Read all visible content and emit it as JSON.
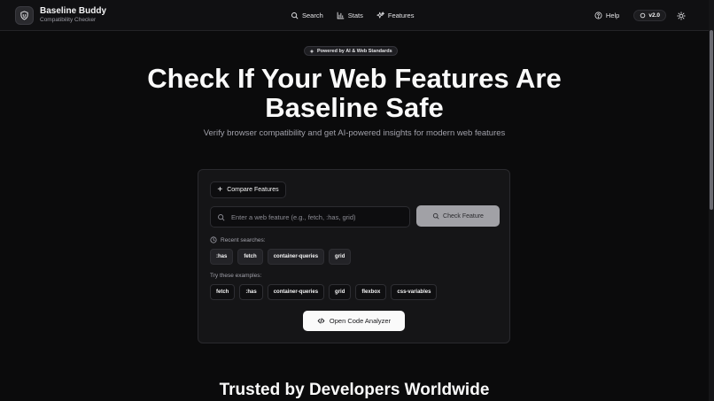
{
  "header": {
    "brand_title": "Baseline Buddy",
    "brand_subtitle": "Compatibility Checker",
    "nav": [
      {
        "label": "Search",
        "icon": "search-icon"
      },
      {
        "label": "Stats",
        "icon": "bar-chart-icon"
      },
      {
        "label": "Features",
        "icon": "sparkles-icon"
      }
    ],
    "help_label": "Help",
    "version_label": "v2.0"
  },
  "hero": {
    "badge": "Powered by AI & Web Standards",
    "title_line1": "Check If Your Web Features Are",
    "title_line2": "Baseline Safe",
    "subtitle": "Verify browser compatibility and get AI-powered insights for modern web features"
  },
  "card": {
    "compare_label": "Compare Features",
    "search_placeholder": "Enter a web feature (e.g., fetch, :has, grid)",
    "check_label": "Check Feature",
    "recent_label": "Recent searches:",
    "recent": [
      ":has",
      "fetch",
      "container-queries",
      "grid"
    ],
    "examples_label": "Try these examples:",
    "examples": [
      "fetch",
      ":has",
      "container-queries",
      "grid",
      "flexbox",
      "css-variables"
    ],
    "analyzer_label": "Open Code Analyzer"
  },
  "footer": {
    "trusted_title": "Trusted by Developers Worldwide"
  },
  "colors": {
    "background": "#0b0b0c",
    "card": "#151517",
    "primary_button": "#fafafa",
    "disabled_button": "#a1a1a6"
  }
}
